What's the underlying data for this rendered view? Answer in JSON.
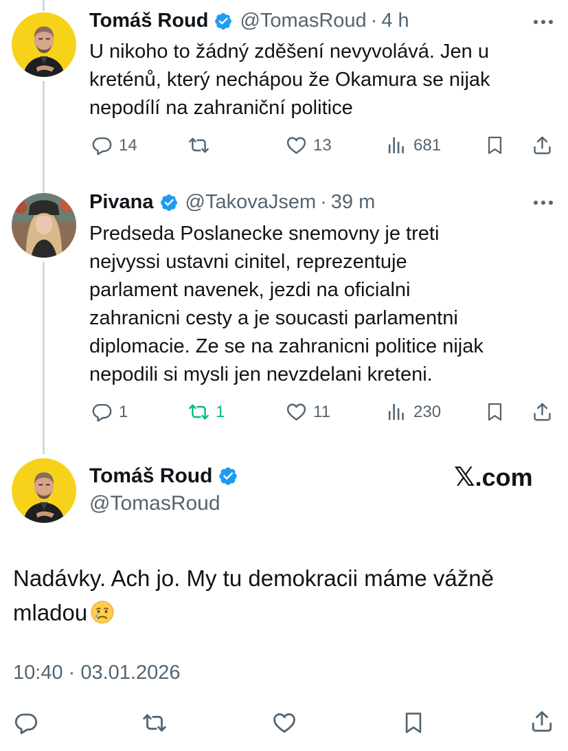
{
  "tweets": [
    {
      "display_name": "Tomáš Roud",
      "handle": "@TomasRoud",
      "separator": "·",
      "time": "4 h",
      "text": "U nikoho to žádný zděšení nevyvolává. Jen u\nkreténů, který nechápou že Okamura se nijak\nnepodílí na zahraniční politice",
      "replies": "14",
      "reposts": "",
      "likes": "13",
      "views": "681"
    },
    {
      "display_name": "Pivana",
      "handle": "@TakovaJsem",
      "separator": "·",
      "time": "39 m",
      "text": "Predseda Poslanecke snemovny je treti\nnejvyssi ustavni cinitel, reprezentuje\nparlament navenek, jezdi na oficialni\nzahranicni cesty a je soucasti parlamentni\ndiplomacie. Ze se na zahranicni politice nijak\nnepodili si mysli jen nevzdelani kreteni.",
      "replies": "1",
      "reposts": "1",
      "likes": "11",
      "views": "230"
    }
  ],
  "main_tweet": {
    "display_name": "Tomáš Roud",
    "handle": "@TomasRoud",
    "watermark_x": "𝕏",
    "watermark_domain": ".com",
    "text": "Nadávky. Ach jo. My tu demokracii máme vážně mladou",
    "emoji": "crying-face",
    "timestamp": "10:40 · 03.01.2026"
  },
  "colors": {
    "text": "#0f1419",
    "secondary": "#536471",
    "verified": "#1d9bf0",
    "repost_active": "#00ba7c",
    "thread_line": "#cfd9de",
    "avatar_bg": "#f6d21a"
  },
  "icons": [
    "verified-badge-icon",
    "more-icon",
    "reply-icon",
    "repost-icon",
    "like-icon",
    "views-icon",
    "bookmark-icon",
    "share-icon",
    "crying-face-emoji"
  ]
}
